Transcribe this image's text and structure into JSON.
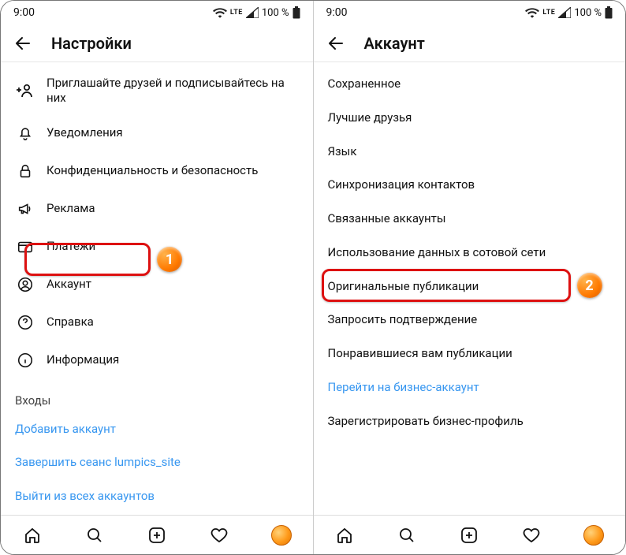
{
  "status": {
    "time": "9:00",
    "net_label": "LTE",
    "battery": "100 %"
  },
  "left": {
    "title": "Настройки",
    "items": [
      {
        "label": "Приглашайте друзей и подписывайтесь на них"
      },
      {
        "label": "Уведомления"
      },
      {
        "label": "Конфиденциальность и безопасность"
      },
      {
        "label": "Реклама"
      },
      {
        "label": "Платежи"
      },
      {
        "label": "Аккаунт"
      },
      {
        "label": "Справка"
      },
      {
        "label": "Информация"
      }
    ],
    "logins_section": "Входы",
    "logins": [
      "Добавить аккаунт",
      "Завершить сеанс lumpics_site",
      "Выйти из всех аккаунтов"
    ],
    "badge": "1"
  },
  "right": {
    "title": "Аккаунт",
    "items": [
      "Сохраненное",
      "Лучшие друзья",
      "Язык",
      "Синхронизация контактов",
      "Связанные аккаунты",
      "Использование данных в сотовой сети",
      "Оригинальные публикации",
      "Запросить подтверждение",
      "Понравившиеся вам публикации",
      "Перейти на бизнес-аккаунт",
      "Зарегистрировать бизнес-профиль"
    ],
    "badge": "2"
  }
}
